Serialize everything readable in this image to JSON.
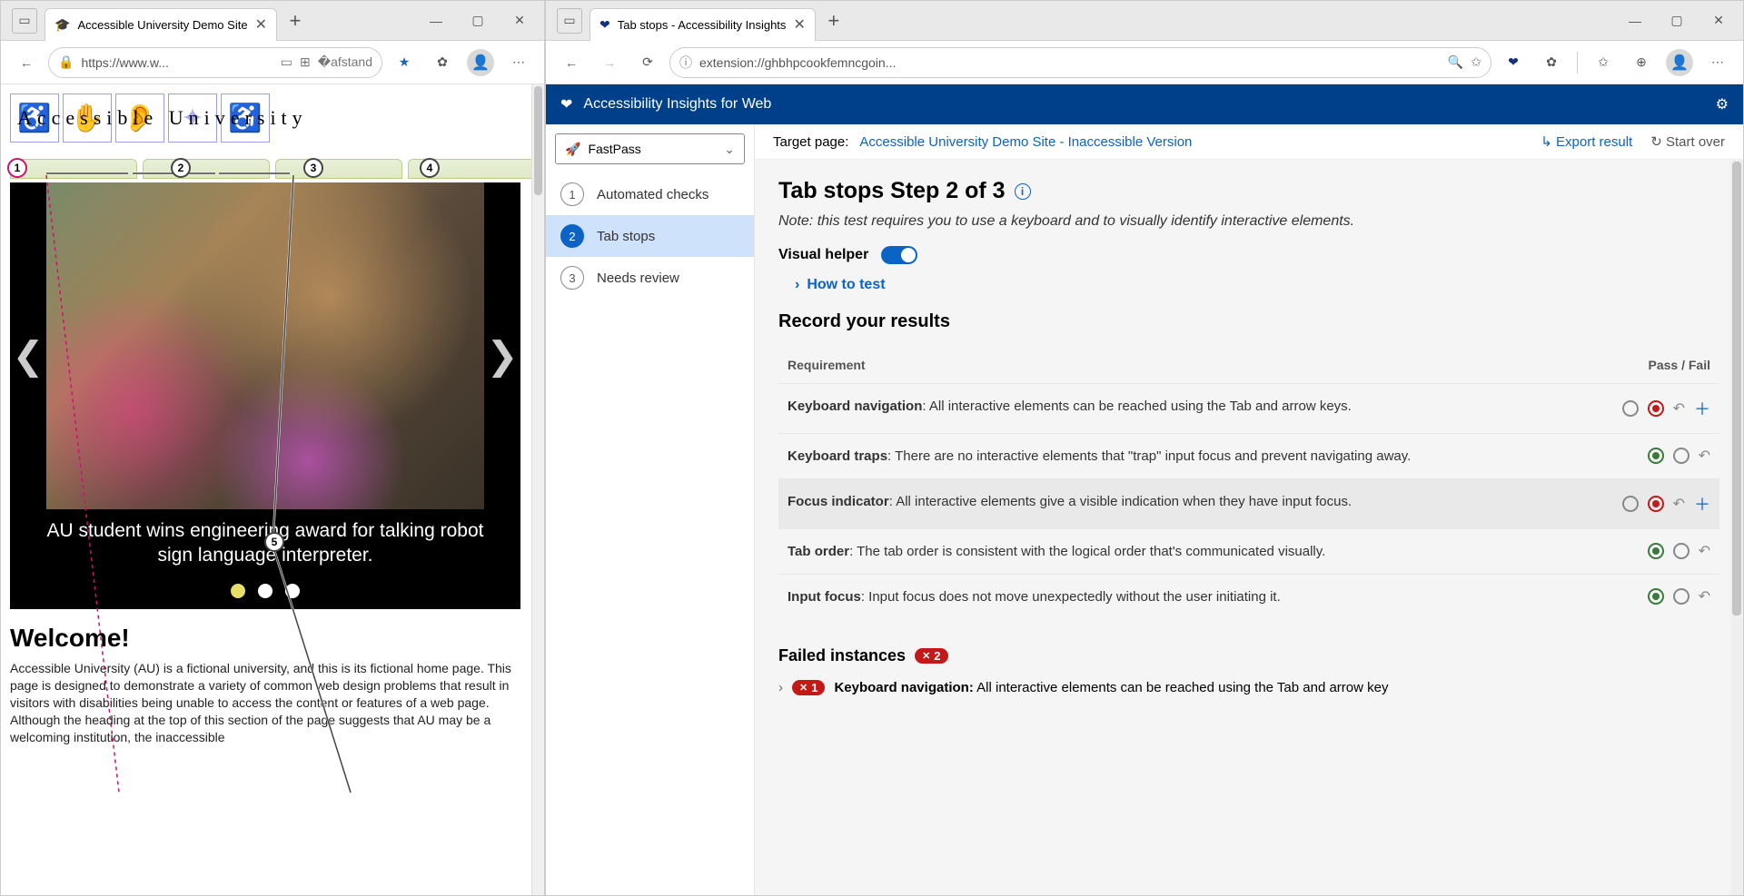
{
  "left": {
    "tab_title": "Accessible University Demo Site",
    "url": "https://www.w...",
    "au_title": "Accessible University",
    "tabstops": [
      "1",
      "2",
      "3",
      "4",
      "5"
    ],
    "caption": "AU student wins engineering award for talking robot sign language interpreter.",
    "welcome": "Welcome!",
    "body": "Accessible University (AU) is a fictional university, and this is its fictional home page. This page is designed to demonstrate a variety of common web design problems that result in visitors with disabilities being unable to access the content or features of a web page. Although the heading at the top of this section of the page suggests that AU may be a welcoming institution, the inaccessible"
  },
  "right": {
    "tab_title": "Tab stops - Accessibility Insights",
    "url": "extension://ghbhpcookfemncgoin...",
    "ai_title": "Accessibility Insights for Web",
    "dropdown": "FastPass",
    "nav": [
      {
        "n": "1",
        "label": "Automated checks"
      },
      {
        "n": "2",
        "label": "Tab stops"
      },
      {
        "n": "3",
        "label": "Needs review"
      }
    ],
    "target_label": "Target page:",
    "target_link": "Accessible University Demo Site - Inaccessible Version",
    "export": "Export result",
    "startover": "Start over",
    "heading": "Tab stops Step 2 of 3",
    "note": "Note: this test requires you to use a keyboard and to visually identify interactive elements.",
    "visual_helper": "Visual helper",
    "howto": "How to test",
    "record": "Record your results",
    "col_req": "Requirement",
    "col_pf": "Pass / Fail",
    "reqs": [
      {
        "name": "Keyboard navigation",
        "desc": ": All interactive elements can be reached using the Tab and arrow keys.",
        "pass": "off",
        "fail": "on",
        "plus": true
      },
      {
        "name": "Keyboard traps",
        "desc": ": There are no interactive elements that \"trap\" input focus and prevent navigating away.",
        "pass": "on",
        "fail": "off",
        "plus": false
      },
      {
        "name": "Focus indicator",
        "desc": ": All interactive elements give a visible indication when they have input focus.",
        "pass": "off",
        "fail": "on",
        "plus": true,
        "hover": true
      },
      {
        "name": "Tab order",
        "desc": ": The tab order is consistent with the logical order that's communicated visually.",
        "pass": "on",
        "fail": "off",
        "plus": false
      },
      {
        "name": "Input focus",
        "desc": ": Input focus does not move unexpectedly without the user initiating it.",
        "pass": "on",
        "fail": "off",
        "plus": false
      }
    ],
    "failed_label": "Failed instances",
    "failed_count": "2",
    "failed_item_badge": "1",
    "failed_item_name": "Keyboard navigation:",
    "failed_item_desc": " All interactive elements can be reached using the Tab and arrow key"
  }
}
